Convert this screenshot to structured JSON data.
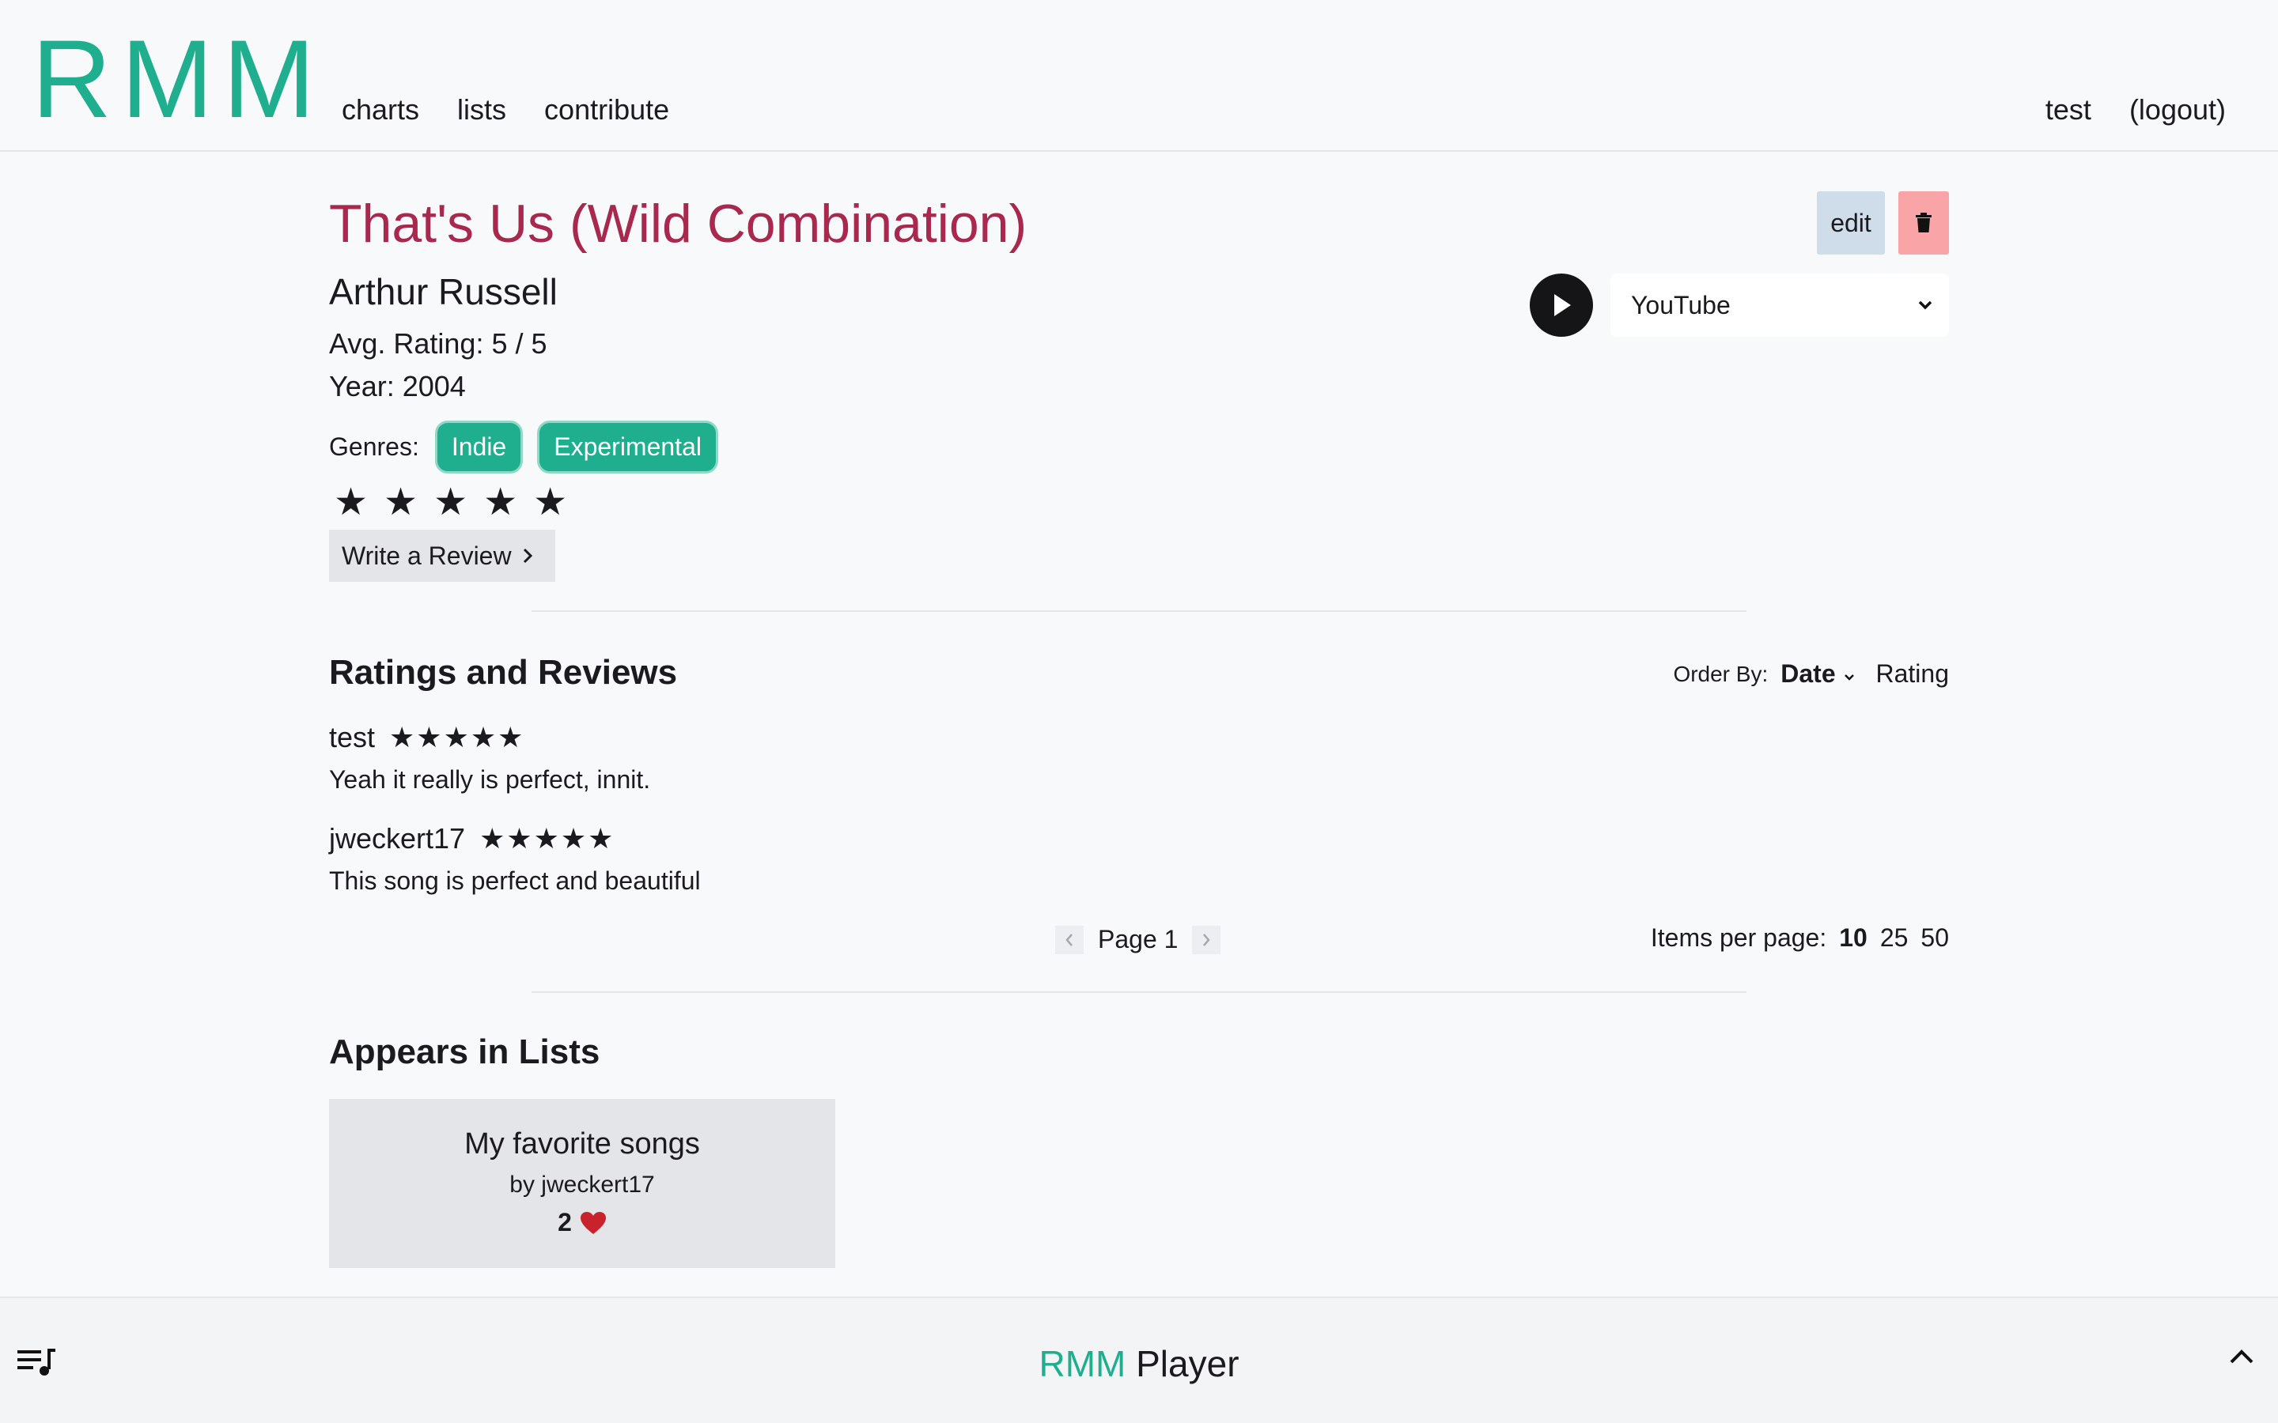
{
  "header": {
    "logo": "RMM",
    "nav": [
      "charts",
      "lists",
      "contribute"
    ],
    "user": "test",
    "logout": "(logout)"
  },
  "song": {
    "title": "That's Us (Wild Combination)",
    "artist": "Arthur Russell",
    "avg_rating": "Avg. Rating: 5 / 5",
    "year": "Year: 2004",
    "genres_label": "Genres:",
    "genres": [
      "Indie",
      "Experimental"
    ],
    "user_rating_stars": 5,
    "write_review": "Write a Review",
    "edit_label": "edit",
    "delete_icon": "trash-icon",
    "play_icon": "play-icon",
    "source": "YouTube"
  },
  "reviews": {
    "title": "Ratings and Reviews",
    "order_by_label": "Order By:",
    "order_date": "Date",
    "order_rating": "Rating",
    "items": [
      {
        "user": "test",
        "stars": "★★★★★",
        "text": "Yeah it really is perfect, innit."
      },
      {
        "user": "jweckert17",
        "stars": "★★★★★",
        "text": "This song is perfect and beautiful"
      }
    ],
    "page_label": "Page 1",
    "items_per_page_label": "Items per page:",
    "items_per_page": [
      "10",
      "25",
      "50"
    ],
    "items_per_page_selected": "10"
  },
  "lists": {
    "title": "Appears in Lists",
    "cards": [
      {
        "name": "My favorite songs",
        "by": "by jweckert17",
        "likes": "2"
      }
    ]
  },
  "player": {
    "brand": "RMM",
    "label": "Player"
  },
  "colors": {
    "brand": "#1fae8e",
    "title": "#a8284e",
    "edit": "#cfdcea",
    "delete": "#f9a5a7",
    "heart": "#c8222c"
  }
}
